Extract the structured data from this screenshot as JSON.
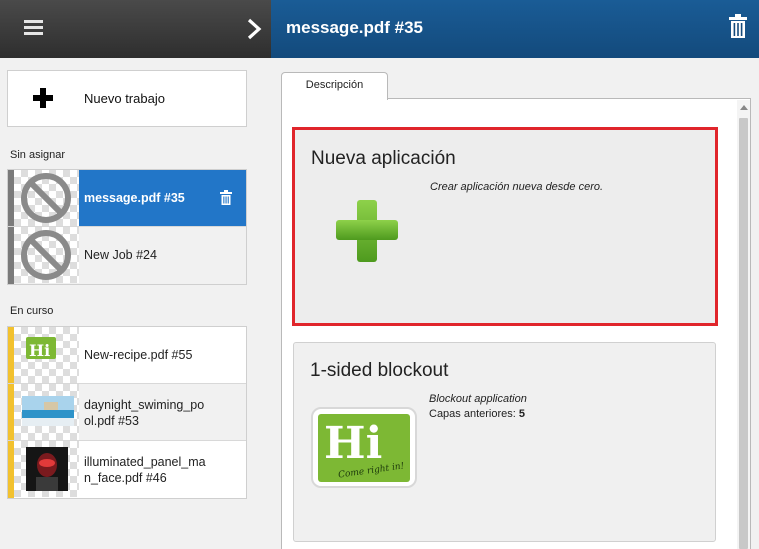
{
  "sidebar": {
    "new_job_label": "Nuevo trabajo",
    "sections": [
      {
        "label": "Sin asignar"
      },
      {
        "label": "En curso"
      }
    ],
    "unassigned_jobs": [
      {
        "name": "message.pdf #35",
        "active": true
      },
      {
        "name": "New Job #24",
        "active": false
      }
    ],
    "in_progress_jobs": [
      {
        "name": "New-recipe.pdf #55"
      },
      {
        "name": "daynight_swiming_po ol.pdf #53"
      },
      {
        "name": "illuminated_panel_ma n_face.pdf #46"
      }
    ]
  },
  "header": {
    "title": "message.pdf #35"
  },
  "tabs": [
    {
      "label": "Descripción"
    }
  ],
  "cards": [
    {
      "title": "Nueva aplicación",
      "description": "Crear aplicación nueva desde cero.",
      "icon": "green-plus-icon"
    },
    {
      "title": "1-sided blockout",
      "description": "Blockout application",
      "prev_label": "Capas anteriores:",
      "prev_value": "5",
      "logo": {
        "text": "Hi",
        "sub": "Come right in!"
      }
    }
  ],
  "colors": {
    "accent_blue": "#2276c8",
    "header_blue": "#134a7c",
    "status_in_progress": "#f2c12e",
    "status_unassigned": "#7a7a7a",
    "selection_red": "#e0252b",
    "logo_green": "#7db834"
  }
}
